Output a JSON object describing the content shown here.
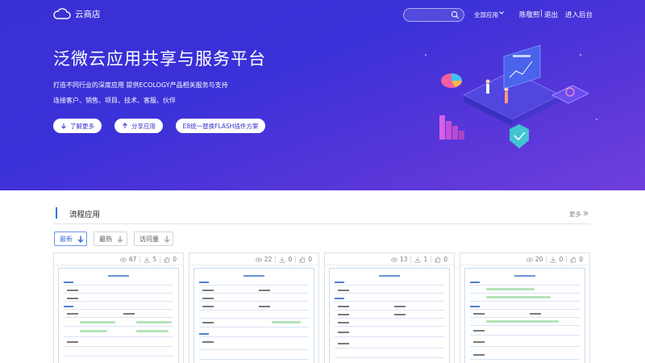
{
  "header": {
    "logo_icon": "cloud-icon",
    "logo_text": "云商店",
    "search_placeholder": "",
    "all_apps": "全部应用",
    "user_name": "陈敬熙",
    "separator": "|",
    "logout": "退出",
    "backend": "进入后台"
  },
  "hero": {
    "title": "泛微云应用共享与服务平台",
    "subtitle1": "打造不同行业的深度应用 提供ECOLOGY产品相关服务与支持",
    "subtitle2": "连接客户、销售、项目、技术、客服、伙伴",
    "buttons": [
      {
        "label": "了解更多",
        "icon": "arrow-down-icon"
      },
      {
        "label": "分享应用",
        "icon": "arrow-up-icon"
      },
      {
        "label": "E8统一替换FLASH插件方案",
        "icon": ""
      }
    ],
    "gradient_start": "#3a2fd4",
    "gradient_end": "#6f3fdc"
  },
  "section": {
    "title": "流程应用",
    "more": "更多",
    "accent": "#3b6fe0",
    "sort_options": [
      {
        "label": "最新",
        "active": true
      },
      {
        "label": "最热",
        "active": false
      },
      {
        "label": "访问量",
        "active": false
      }
    ]
  },
  "cards": [
    {
      "views": "67",
      "downloads": "5",
      "likes": "0"
    },
    {
      "views": "22",
      "downloads": "0",
      "likes": "0"
    },
    {
      "views": "13",
      "downloads": "1",
      "likes": "0"
    },
    {
      "views": "20",
      "downloads": "0",
      "likes": "0"
    }
  ]
}
